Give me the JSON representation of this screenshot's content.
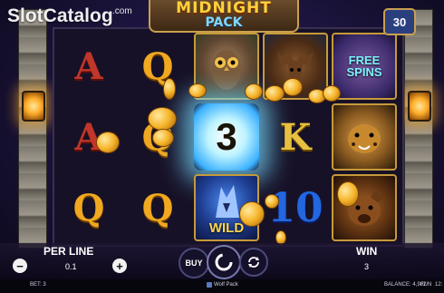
{
  "watermark": {
    "brand": "SlotCatalog",
    "domain": ".com"
  },
  "game_logo": {
    "title": "MIDNIGHT",
    "subtitle": "PACK"
  },
  "lines_badge": "30",
  "reels": [
    [
      "A",
      "A",
      "Q"
    ],
    [
      "Q",
      "Q",
      "Q"
    ],
    [
      "owl",
      "3",
      "WILD"
    ],
    [
      "moose",
      "K",
      "10"
    ],
    [
      "FREE SPINS",
      "jaguar",
      "bear"
    ]
  ],
  "controls": {
    "per_line_label": "PER LINE",
    "per_line_value": "0.1",
    "minus_label": "−",
    "plus_label": "+",
    "buy_label": "BUY",
    "win_label": "WIN",
    "win_value": "3"
  },
  "status": {
    "bet": "BET: 3",
    "game_name": "Wolf Pack",
    "balance": "BALANCE: 4,982",
    "mode": "FUN",
    "time": "12:"
  },
  "icons": [
    "minus-icon",
    "plus-icon",
    "spin-icon",
    "autoplay-icon",
    "wolf-icon"
  ]
}
